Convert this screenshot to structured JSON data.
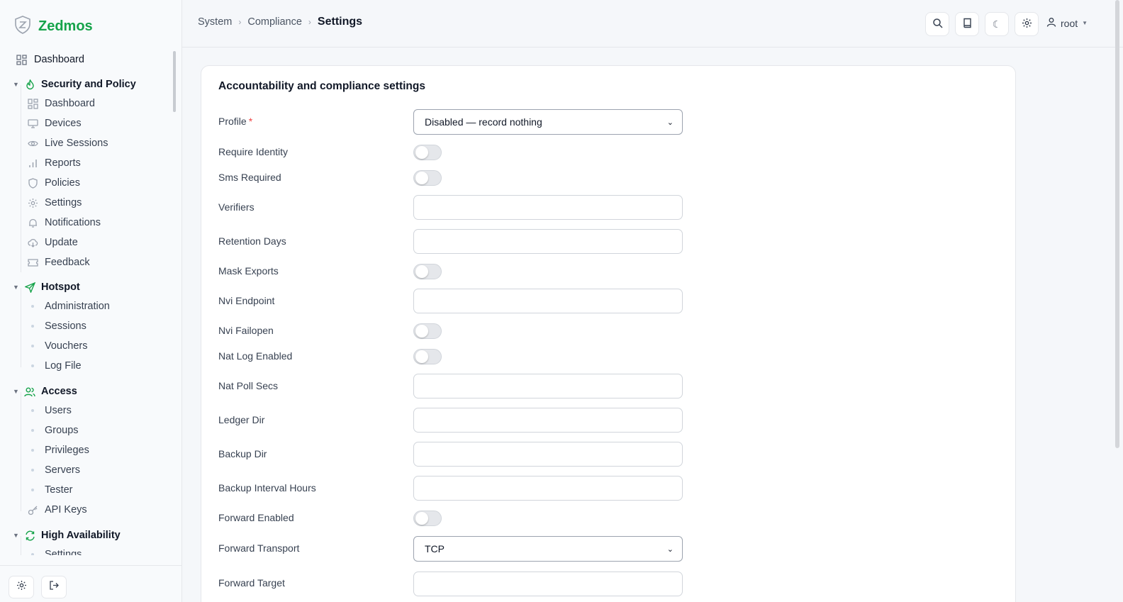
{
  "brand": {
    "name": "Zedmos",
    "color": "#16a34a"
  },
  "nav": {
    "top": {
      "label": "Dashboard",
      "icon": "dashboard-icon"
    },
    "groups": [
      {
        "label": "Security and Policy",
        "icon": "flame-icon",
        "items": [
          {
            "label": "Dashboard",
            "icon": "dashboard-icon"
          },
          {
            "label": "Devices",
            "icon": "monitor-icon"
          },
          {
            "label": "Live Sessions",
            "icon": "eye-icon"
          },
          {
            "label": "Reports",
            "icon": "bar-chart-icon"
          },
          {
            "label": "Policies",
            "icon": "shield-icon"
          },
          {
            "label": "Settings",
            "icon": "gear-icon"
          },
          {
            "label": "Notifications",
            "icon": "bell-icon"
          },
          {
            "label": "Update",
            "icon": "cloud-download-icon"
          },
          {
            "label": "Feedback",
            "icon": "ticket-icon"
          }
        ]
      },
      {
        "label": "Hotspot",
        "icon": "send-icon",
        "items": [
          {
            "label": "Administration"
          },
          {
            "label": "Sessions"
          },
          {
            "label": "Vouchers"
          },
          {
            "label": "Log File"
          }
        ]
      },
      {
        "label": "Access",
        "icon": "users-icon",
        "items": [
          {
            "label": "Users"
          },
          {
            "label": "Groups"
          },
          {
            "label": "Privileges"
          },
          {
            "label": "Servers"
          },
          {
            "label": "Tester"
          },
          {
            "label": "API Keys",
            "icon": "key-icon"
          }
        ]
      },
      {
        "label": "High Availability",
        "icon": "refresh-icon",
        "items": [
          {
            "label": "Settings"
          }
        ]
      }
    ]
  },
  "breadcrumb": [
    "System",
    "Compliance",
    "Settings"
  ],
  "header": {
    "user": "root"
  },
  "form": {
    "title": "Accountability and compliance settings",
    "fields": [
      {
        "label": "Profile",
        "required": "*",
        "type": "select",
        "value": "Disabled — record nothing"
      },
      {
        "label": "Require Identity",
        "type": "toggle",
        "value": "off"
      },
      {
        "label": "Sms Required",
        "type": "toggle",
        "value": "off"
      },
      {
        "label": "Verifiers",
        "type": "text",
        "value": ""
      },
      {
        "label": "Retention Days",
        "type": "text",
        "value": ""
      },
      {
        "label": "Mask Exports",
        "type": "toggle",
        "value": "off"
      },
      {
        "label": "Nvi Endpoint",
        "type": "text",
        "value": ""
      },
      {
        "label": "Nvi Failopen",
        "type": "toggle",
        "value": "off"
      },
      {
        "label": "Nat Log Enabled",
        "type": "toggle",
        "value": "off"
      },
      {
        "label": "Nat Poll Secs",
        "type": "text",
        "value": ""
      },
      {
        "label": "Ledger Dir",
        "type": "text",
        "value": ""
      },
      {
        "label": "Backup Dir",
        "type": "text",
        "value": ""
      },
      {
        "label": "Backup Interval Hours",
        "type": "text",
        "value": ""
      },
      {
        "label": "Forward Enabled",
        "type": "toggle",
        "value": "off"
      },
      {
        "label": "Forward Transport",
        "type": "select",
        "value": "TCP"
      },
      {
        "label": "Forward Target",
        "type": "text",
        "value": ""
      }
    ]
  }
}
